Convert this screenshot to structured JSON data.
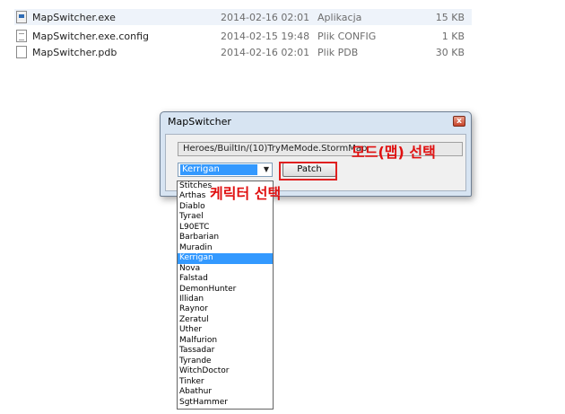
{
  "files": [
    {
      "name": "MapSwitcher.exe",
      "date": "2014-02-16 02:01",
      "type": "Aplikacja",
      "size": "15 KB",
      "icon": "exe-file-icon"
    },
    {
      "name": "MapSwitcher.exe.config",
      "date": "2014-02-15 19:48",
      "type": "Plik CONFIG",
      "size": "1 KB",
      "icon": "document-file-icon"
    },
    {
      "name": "MapSwitcher.pdb",
      "date": "2014-02-16 02:01",
      "type": "Plik PDB",
      "size": "30 KB",
      "icon": "blank-file-icon"
    }
  ],
  "dialog": {
    "title": "MapSwitcher",
    "close_label": "x",
    "map_path": "Heroes/BuiltIn/(10)TryMeMode.StormMap",
    "selected_character": "Kerrigan",
    "patch_label": "Patch"
  },
  "annotations": {
    "mode_select": "모드(맵) 선택",
    "character_select": "케릭터 선택"
  },
  "dropdown_items": [
    "Stitches",
    "Arthas",
    "Diablo",
    "Tyrael",
    "L90ETC",
    "Barbarian",
    "Muradin",
    "Kerrigan",
    "Nova",
    "Falstad",
    "DemonHunter",
    "Illidan",
    "Raynor",
    "Zeratul",
    "Uther",
    "Malfurion",
    "Tassadar",
    "Tyrande",
    "WitchDoctor",
    "Tinker",
    "Abathur",
    "SgtHammer"
  ],
  "dropdown_selected": "Kerrigan",
  "colors": {
    "selection": "#3399ff",
    "annotation": "#e01010"
  }
}
